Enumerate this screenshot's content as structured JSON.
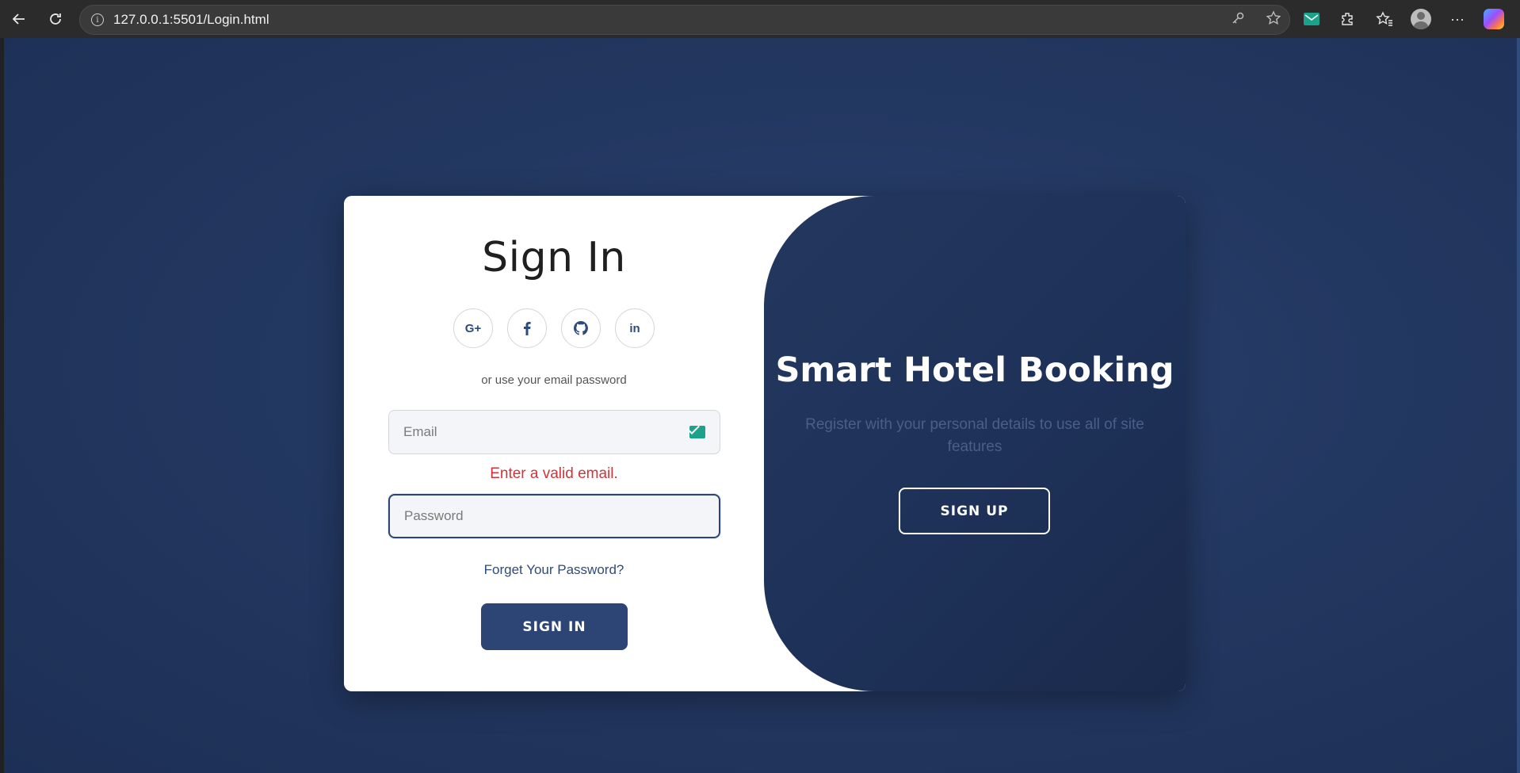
{
  "browser": {
    "url": "127.0.0.1:5501/Login.html"
  },
  "login": {
    "title": "Sign In",
    "socials": [
      {
        "label": "G+",
        "icon": "google-plus-icon"
      },
      {
        "label": "f",
        "icon": "facebook-icon"
      },
      {
        "label": "◯",
        "icon": "github-icon"
      },
      {
        "label": "in",
        "icon": "linkedin-icon"
      }
    ],
    "alt_text": "or use your email password",
    "email_placeholder": "Email",
    "email_error": "Enter a valid email.",
    "password_placeholder": "Password",
    "forgot_link": "Forget Your Password?",
    "signin_button": "SIGN IN"
  },
  "side": {
    "title": "Smart Hotel Booking",
    "text": "Register with your personal details to use all of site features",
    "signup_button": "SIGN UP"
  },
  "colors": {
    "accent": "#2c4574",
    "background": "#233861",
    "error": "#d0343a"
  }
}
